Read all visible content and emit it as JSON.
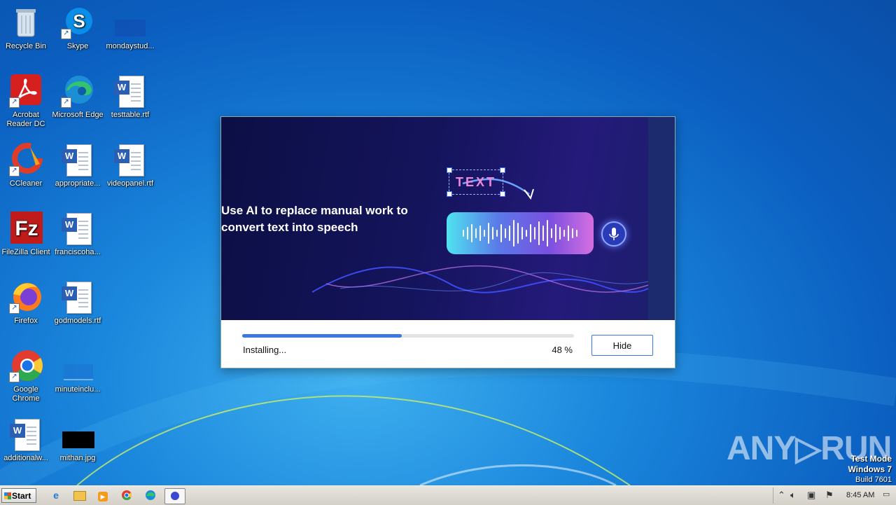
{
  "desktop": {
    "icons": [
      {
        "label": "Recycle Bin"
      },
      {
        "label": "Skype"
      },
      {
        "label": "mondaystud..."
      },
      {
        "label": "Acrobat Reader DC"
      },
      {
        "label": "Microsoft Edge"
      },
      {
        "label": "testtable.rtf"
      },
      {
        "label": "CCleaner"
      },
      {
        "label": "appropriate..."
      },
      {
        "label": "videopanel.rtf"
      },
      {
        "label": "FileZilla Client"
      },
      {
        "label": "franciscoha..."
      },
      {
        "label": "Firefox"
      },
      {
        "label": "godmodels.rtf"
      },
      {
        "label": "Google Chrome"
      },
      {
        "label": "minuteinclu..."
      },
      {
        "label": "additionalw..."
      },
      {
        "label": "mithan.jpg"
      }
    ]
  },
  "installer": {
    "headline_line1": "Use AI to replace manual work to",
    "headline_line2": "convert text into speech",
    "tag_text": "TEXT",
    "status": "Installing...",
    "percent_label": "48 %",
    "progress": 0.48,
    "hide_label": "Hide"
  },
  "watermark": {
    "text": "ANY▷RUN",
    "test_mode": "Test Mode",
    "os": "Windows 7",
    "build": "Build 7601"
  },
  "taskbar": {
    "start_label": "Start",
    "clock": "8:45 AM",
    "pinned_icons": [
      "ie-icon",
      "explorer-icon",
      "media-player-icon",
      "chrome-icon",
      "edge-icon",
      "installer-app-icon"
    ]
  }
}
